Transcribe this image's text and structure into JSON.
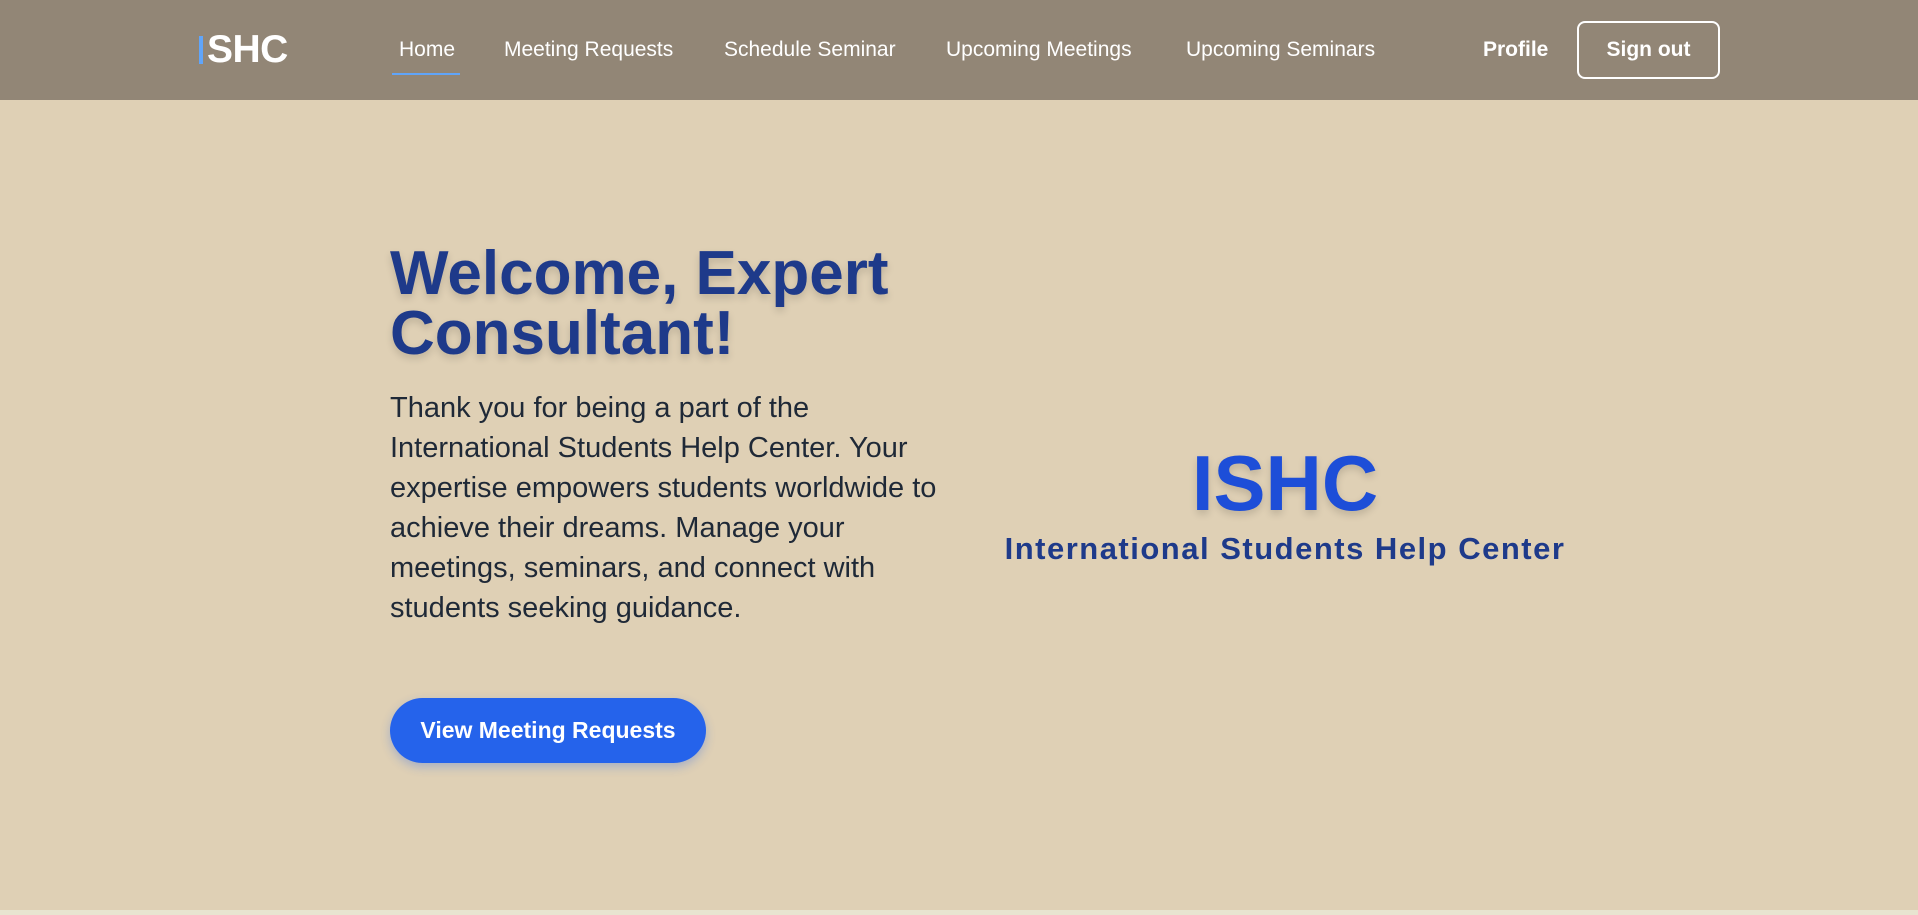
{
  "header": {
    "logo_text": "SHC",
    "nav": [
      {
        "label": "Home",
        "active": true
      },
      {
        "label": "Meeting Requests",
        "active": false
      },
      {
        "label": "Schedule Seminar",
        "active": false
      },
      {
        "label": "Upcoming Meetings",
        "active": false
      },
      {
        "label": "Upcoming Seminars",
        "active": false
      }
    ],
    "profile_label": "Profile",
    "signout_label": "Sign out"
  },
  "hero": {
    "title": "Welcome, Expert Consultant!",
    "description": "Thank you for being a part of the International Students Help Center. Your expertise empowers students worldwide to achieve their dreams. Manage your meetings, seminars, and connect with students seeking guidance.",
    "cta_label": "View Meeting Requests"
  },
  "brand": {
    "title": "ISHC",
    "subtitle": "International Students Help Center"
  },
  "colors": {
    "page_background": "#dfd0b5",
    "navbar_background": "#928676",
    "accent": "#2563eb",
    "heading": "#1e3a8a",
    "nav_active_underline": "#60a5fa"
  }
}
